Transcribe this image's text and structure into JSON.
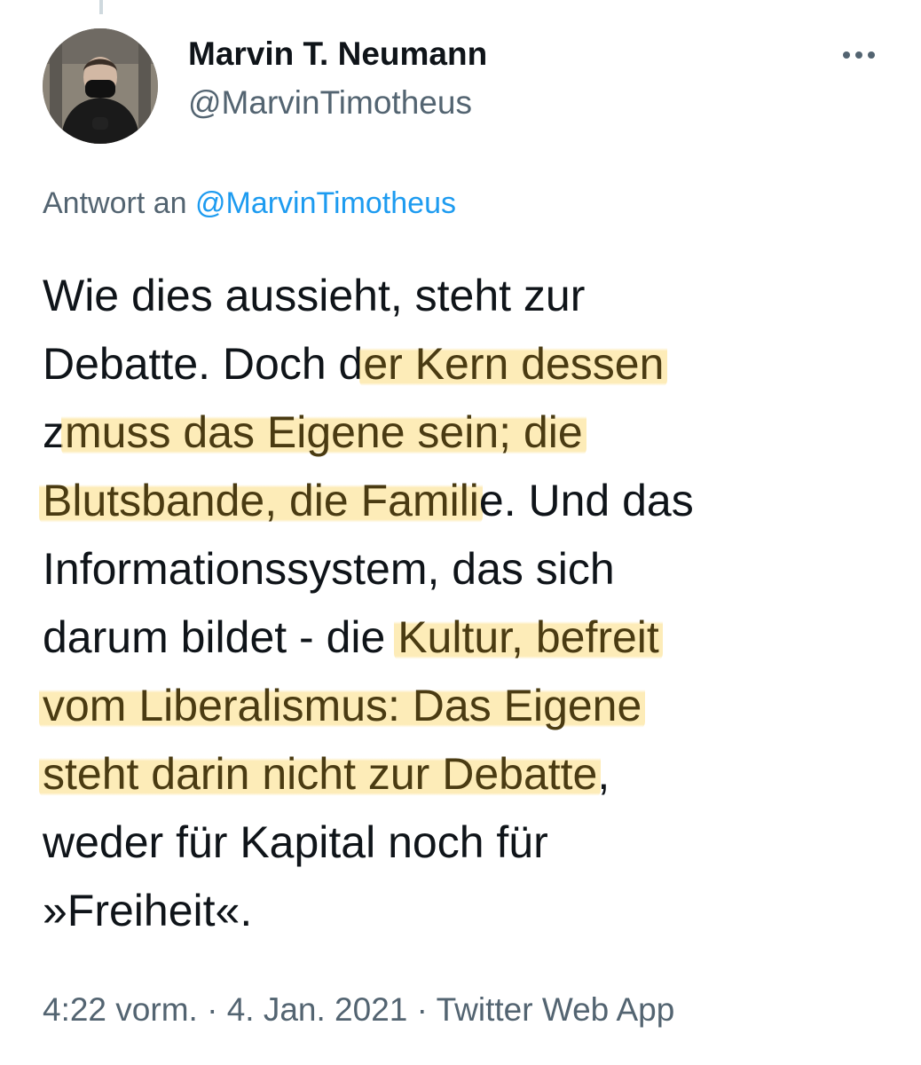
{
  "author": {
    "display_name": "Marvin T. Neumann",
    "handle": "@MarvinTimotheus",
    "avatar_icon": "profile-photo"
  },
  "more_icon": "more-horizontal-icon",
  "reply": {
    "prefix": "Antwort an",
    "handle": "@MarvinTimotheus"
  },
  "tweet": {
    "lines": [
      [
        {
          "text": "Wie dies aussieht, steht zur",
          "hl": false
        }
      ],
      [
        {
          "text": "Debatte. Doch d",
          "hl": false
        },
        {
          "text": "er Kern dessen",
          "hl": true
        }
      ],
      [
        {
          "text": "z",
          "hl": false
        },
        {
          "text": "muss das Eigene sein; die",
          "hl": true
        }
      ],
      [
        {
          "text": "Blutsbande, die Famili",
          "hl": true
        },
        {
          "text": "e. Und das",
          "hl": false
        }
      ],
      [
        {
          "text": "Informationssystem, das sich",
          "hl": false
        }
      ],
      [
        {
          "text": "darum bildet - die ",
          "hl": false
        },
        {
          "text": "Kultur, befreit",
          "hl": true
        }
      ],
      [
        {
          "text": "vom Liberalismus: Das Eigene",
          "hl": true
        }
      ],
      [
        {
          "text": "steht darin nicht zur Debatte",
          "hl": true
        },
        {
          "text": ",",
          "hl": false
        }
      ],
      [
        {
          "text": "weder für Kapital noch für",
          "hl": false
        }
      ],
      [
        {
          "text": "»Freiheit«.",
          "hl": false
        }
      ]
    ],
    "highlight_color": "#fce08c"
  },
  "meta": {
    "time": "4:22 vorm.",
    "separator": " · ",
    "date": "4. Jan. 2021",
    "source": "Twitter Web App"
  },
  "colors": {
    "text": "#0f1419",
    "secondary": "#536471",
    "link": "#1d9bf0"
  }
}
